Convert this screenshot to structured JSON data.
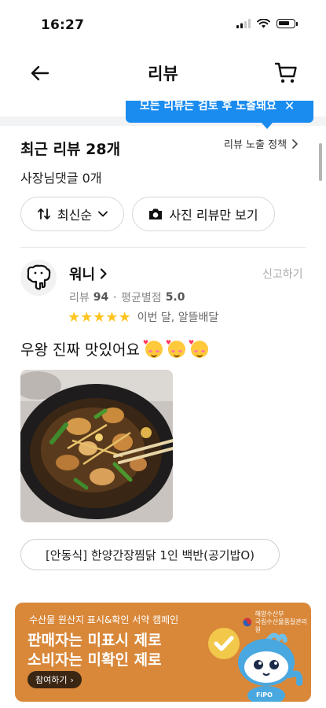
{
  "status_bar": {
    "time": "16:27"
  },
  "header": {
    "title": "리뷰"
  },
  "tooltip": {
    "text": "모든 리뷰는 검토 후 노출돼요",
    "close": "✕"
  },
  "summary": {
    "title": "최근 리뷰 28개",
    "policy_link": "리뷰 노출 정책",
    "owner_reply_count": "사장님댓글 0개"
  },
  "filters": {
    "sort_label": "최신순",
    "photo_only_label": "사진 리뷰만 보기"
  },
  "review": {
    "reviewer_name": "워니",
    "report_label": "신고하기",
    "stats_reviews_label": "리뷰",
    "stats_reviews_count": "94",
    "stats_separator": "•",
    "stats_avg_label": "평균별점",
    "stats_avg_value": "5.0",
    "rating": 5,
    "meta": "이번 달, 알뜰배달",
    "text": "우왕 진짜 맛있어요",
    "menu_tag": "[안동식] 한양간장찜닭 1인 백반(공기밥O)"
  },
  "banner": {
    "small_text": "수산물 원산지 표시&확인 서약 캠페인",
    "headline_1": "판매자는 미표시 제로",
    "headline_2": "소비자는 미확인 제로",
    "button_label": "참여하기",
    "agency_line_1": "해양수산부",
    "agency_line_2": "국립수산물품질관리원",
    "mascot_label": "FiPO"
  },
  "colors": {
    "tooltip": "#1a8cf0",
    "star": "#ffc41f",
    "banner": "#d9883a"
  }
}
